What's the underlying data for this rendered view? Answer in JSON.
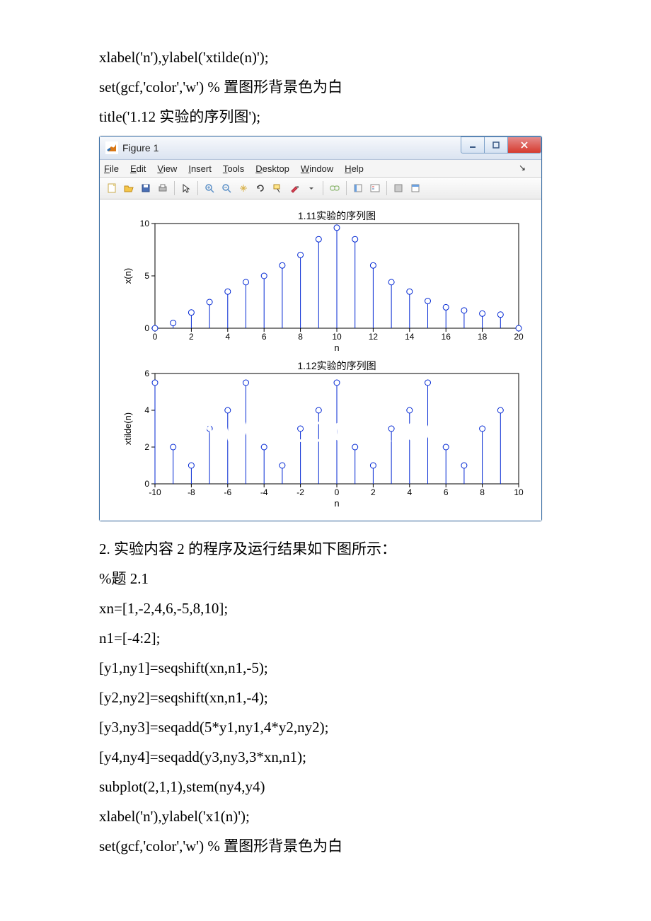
{
  "code_top": [
    "xlabel('n'),ylabel('xtilde(n)');",
    "set(gcf,'color','w') % 置图形背景色为白",
    "title('1.12 实验的序列图');"
  ],
  "figure": {
    "title": "Figure 1",
    "menu": {
      "file": "File",
      "edit": "Edit",
      "view": "View",
      "insert": "Insert",
      "tools": "Tools",
      "desktop": "Desktop",
      "window": "Window",
      "help": "Help"
    },
    "chart1_title": "1.11实验的序列图",
    "chart1_xlabel": "n",
    "chart1_ylabel": "x(n)",
    "chart2_title": "1.12实验的序列图",
    "chart2_xlabel": "n",
    "chart2_ylabel": "xtilde(n)"
  },
  "code_bottom": [
    "2. 实验内容 2 的程序及运行结果如下图所示：",
    "%题 2.1",
    "xn=[1,-2,4,6,-5,8,10];",
    "n1=[-4:2];",
    "[y1,ny1]=seqshift(xn,n1,-5);",
    "[y2,ny2]=seqshift(xn,n1,-4);",
    "[y3,ny3]=seqadd(5*y1,ny1,4*y2,ny2);",
    "[y4,ny4]=seqadd(y3,ny3,3*xn,n1);",
    "subplot(2,1,1),stem(ny4,y4)",
    "xlabel('n'),ylabel('x1(n)');",
    "set(gcf,'color','w') % 置图形背景色为白"
  ],
  "chart_data": [
    {
      "type": "stem",
      "title": "1.11实验的序列图",
      "xlabel": "n",
      "ylabel": "x(n)",
      "xlim": [
        0,
        20
      ],
      "ylim": [
        0,
        10
      ],
      "xticks": [
        0,
        2,
        4,
        6,
        8,
        10,
        12,
        14,
        16,
        18,
        20
      ],
      "yticks": [
        0,
        5,
        10
      ],
      "x": [
        0,
        1,
        2,
        3,
        4,
        5,
        6,
        7,
        8,
        9,
        10,
        11,
        12,
        13,
        14,
        15,
        16,
        17,
        18,
        19,
        20
      ],
      "y": [
        0,
        0.5,
        1.5,
        2.5,
        3.5,
        4.4,
        5.0,
        6.0,
        7.0,
        8.5,
        9.6,
        8.5,
        6.0,
        4.4,
        3.5,
        2.6,
        2.0,
        1.7,
        1.4,
        1.3,
        0
      ]
    },
    {
      "type": "stem",
      "title": "1.12实验的序列图",
      "xlabel": "n",
      "ylabel": "xtilde(n)",
      "xlim": [
        -10,
        10
      ],
      "ylim": [
        0,
        6
      ],
      "xticks": [
        -10,
        -8,
        -6,
        -4,
        -2,
        0,
        2,
        4,
        6,
        8,
        10
      ],
      "yticks": [
        0,
        2,
        4,
        6
      ],
      "x": [
        -10,
        -9,
        -8,
        -7,
        -6,
        -5,
        -4,
        -3,
        -2,
        -1,
        0,
        1,
        2,
        3,
        4,
        5,
        6,
        7,
        8,
        9
      ],
      "y": [
        5.5,
        2,
        1,
        3,
        4,
        5.5,
        2,
        1,
        3,
        4,
        5.5,
        2,
        1,
        3,
        4,
        5.5,
        2,
        1,
        3,
        4
      ]
    }
  ],
  "watermark": "www.bdocx.com"
}
